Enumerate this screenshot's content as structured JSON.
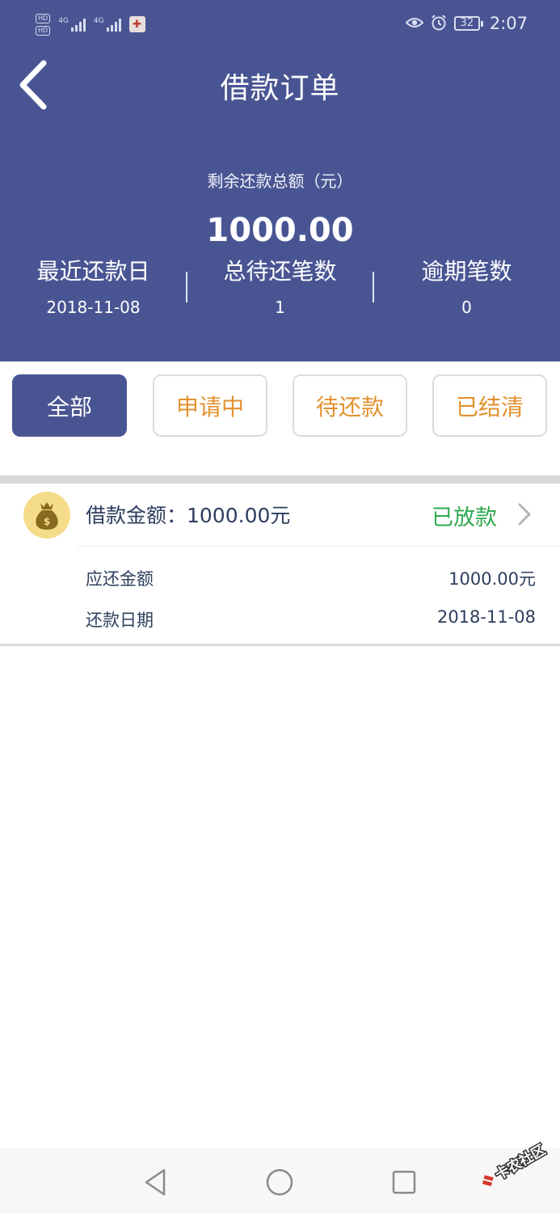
{
  "status_bar": {
    "hd_1": "HD",
    "hd_2": "HD",
    "net_1": "4G",
    "net_2": "4G",
    "battery": "32",
    "time": "2:07",
    "icons": [
      "eye-icon",
      "alarm-icon"
    ]
  },
  "header": {
    "title": "借款订单",
    "back_icon": "chevron-left-icon",
    "background": "#495593"
  },
  "summary": {
    "total_label": "剩余还款总额（元）",
    "total_value": "1000.00",
    "stats": [
      {
        "label": "最近还款日",
        "value": "2018-11-08"
      },
      {
        "label": "总待还笔数",
        "value": "1"
      },
      {
        "label": "逾期笔数",
        "value": "0"
      }
    ]
  },
  "filters": {
    "tabs": [
      {
        "label": "全部",
        "active": true
      },
      {
        "label": "申请中",
        "active": false
      },
      {
        "label": "待还款",
        "active": false
      },
      {
        "label": "已结清",
        "active": false
      }
    ],
    "active_color": "#495593",
    "inactive_text_color": "#e3912e"
  },
  "orders": [
    {
      "icon": "money-bag-icon",
      "amount_text": "借款金额：1000.00元",
      "status": "已放款",
      "status_color": "#2fa84f",
      "rows": [
        {
          "label": "应还金额",
          "value": "1000.00元"
        },
        {
          "label": "还款日期",
          "value": "2018-11-08"
        }
      ]
    }
  ],
  "nav": {
    "icons": [
      "back-triangle-icon",
      "home-circle-icon",
      "recents-square-icon"
    ]
  },
  "watermark": {
    "text": "卡农社区"
  }
}
